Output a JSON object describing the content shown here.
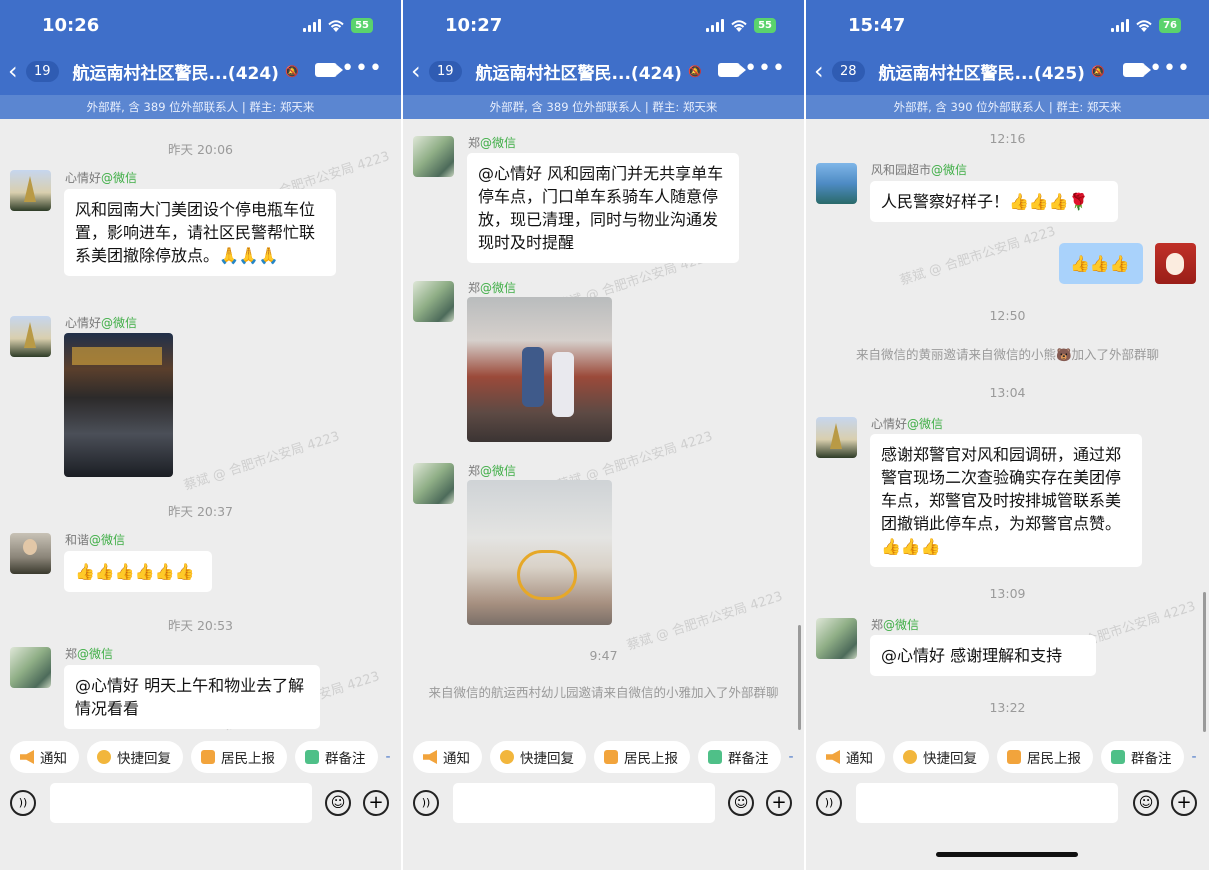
{
  "panels": [
    {
      "status_time": "10:26",
      "battery": "55",
      "badge": "19",
      "title": "航运南村社区警民...(424)",
      "subtitle": "外部群, 含 389 位外部联系人 | 群主: 郑天来",
      "timestamps": [
        "昨天 20:06",
        "昨天 20:37",
        "昨天 20:53"
      ],
      "messages": [
        {
          "sender": "心情好",
          "tag": "@微信",
          "text": "风和园南大门美团设个停电瓶车位置，影响进车，请社区民警帮忙联系美团撤除停放点。🙏🙏🙏"
        },
        {
          "sender": "心情好",
          "tag": "@微信"
        },
        {
          "sender": "和谐",
          "tag": "@微信",
          "text": "👍👍👍👍👍👍"
        },
        {
          "sender": "郑",
          "tag": "@微信",
          "text": "@心情好 明天上午和物业去了解情况看看"
        }
      ]
    },
    {
      "status_time": "10:27",
      "battery": "55",
      "badge": "19",
      "title": "航运南村社区警民...(424)",
      "subtitle": "外部群, 含 389 位外部联系人 | 群主: 郑天来",
      "timestamps": [
        "9:47"
      ],
      "messages": [
        {
          "sender": "郑",
          "tag": "@微信",
          "text": "@心情好 风和园南门并无共享单车停车点，门口单车系骑车人随意停放，现已清理，同时与物业沟通发现时及时提醒"
        },
        {
          "sender": "郑",
          "tag": "@微信"
        },
        {
          "sender": "郑",
          "tag": "@微信"
        }
      ],
      "system": "来自微信的航运西村幼儿园邀请来自微信的小雅加入了外部群聊"
    },
    {
      "status_time": "15:47",
      "battery": "76",
      "badge": "28",
      "title": "航运南村社区警民...(425)",
      "subtitle": "外部群, 含 390 位外部联系人 | 群主: 郑天来",
      "timestamps": [
        "12:16",
        "12:50",
        "13:04",
        "13:09",
        "13:22"
      ],
      "messages": [
        {
          "sender": "风和园超市",
          "tag": "@微信",
          "text": "人民警察好样子！👍👍👍🌹"
        },
        {
          "sender": "",
          "tag": "",
          "text": "👍👍👍"
        },
        {
          "sender": "心情好",
          "tag": "@微信",
          "text": "感谢郑警官对风和园调研，通过郑警官现场二次查验确实存在美团停车点，郑警官及时按排城管联系美团撤销此停车点，为郑警官点赞。👍👍👍"
        },
        {
          "sender": "郑",
          "tag": "@微信",
          "text": "@心情好 感谢理解和支持"
        }
      ],
      "system": "来自微信的黄丽邀请来自微信的小熊🐻加入了外部群聊"
    }
  ],
  "quick_actions": [
    "通知",
    "快捷回复",
    "居民上报",
    "群备注"
  ],
  "watermark": "蔡斌 @ 合肥市公安局 4223",
  "icons": {
    "back": "chevron-left-icon",
    "mute": "mute-bell-icon",
    "video": "video-call-icon",
    "more": "more-dots-icon",
    "voice": "voice-input-icon",
    "emoji": "emoji-icon",
    "plus": "plus-icon"
  },
  "colors": {
    "header": "#3f6fc9",
    "subbar": "#5b86d1",
    "wechat_tag": "#3fae46",
    "my_bubble": "#a9d2fb"
  }
}
